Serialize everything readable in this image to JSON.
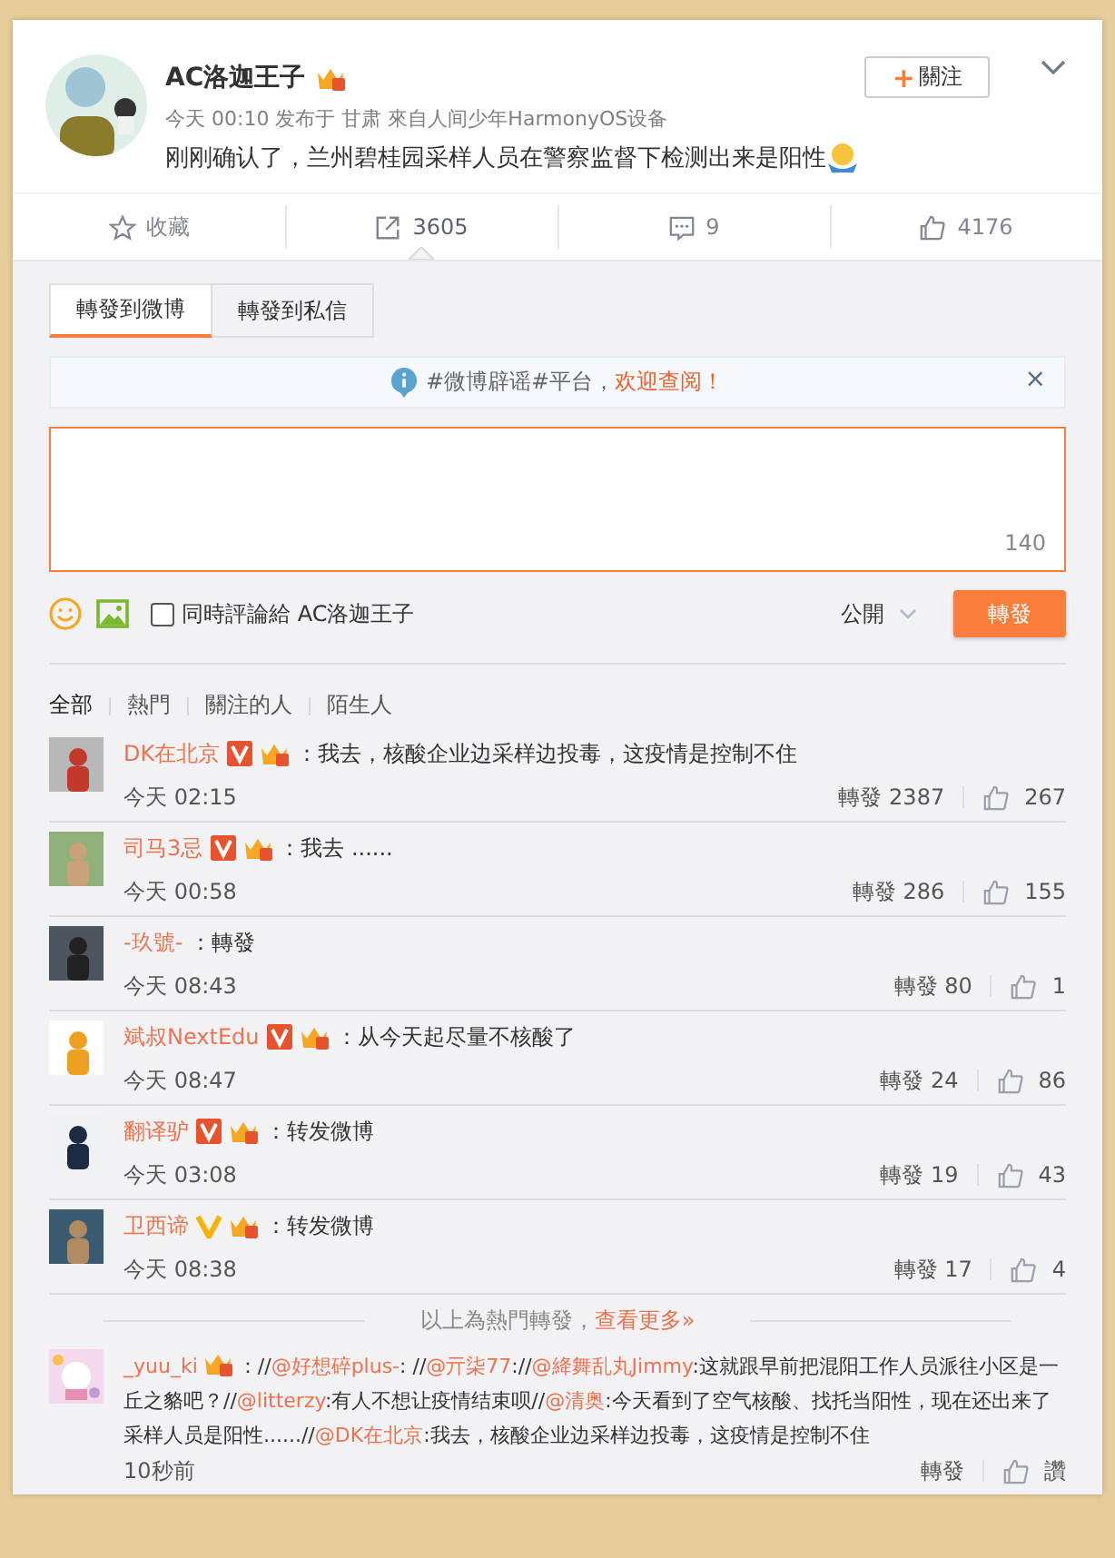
{
  "post": {
    "author": "AC洛迦王子",
    "member": true,
    "follow_button": "關注",
    "follow_plus": "+",
    "meta": "今天 00:10 发布于 甘肃 來自人间少年HarmonyOS设备",
    "text": "刚刚确认了，兰州碧桂园采样人员在警察监督下检测出来是阳性",
    "emoji": true
  },
  "actions": [
    {
      "kind": "favorite",
      "label": "收藏",
      "selected": false
    },
    {
      "kind": "repost",
      "label": "3605",
      "selected": true
    },
    {
      "kind": "comment",
      "label": "9",
      "selected": false
    },
    {
      "kind": "like",
      "label": "4176",
      "selected": false
    }
  ],
  "repost_tabs": [
    {
      "label": "轉發到微博",
      "selected": true
    },
    {
      "label": "轉發到私信",
      "selected": false
    }
  ],
  "notice": {
    "text": "#微博辟谣#平台，",
    "link": "欢迎查阅！",
    "close": "×"
  },
  "composer": {
    "counter": "140",
    "checkbox": {
      "label": "同時評論給 AC洛迦王子",
      "checked": false
    },
    "visibility": "公開",
    "submit": "轉發"
  },
  "filters": [
    {
      "label": "全部",
      "selected": true
    },
    {
      "label": "熱門",
      "selected": false
    },
    {
      "label": "關注的人",
      "selected": false
    },
    {
      "label": "陌生人",
      "selected": false
    }
  ],
  "reposts": [
    {
      "name": "DK在北京",
      "kind": "verified",
      "member": true,
      "text": "：我去，核酸企业边采样边投毒，这疫情是控制不住",
      "time": "今天 02:15",
      "repost": "轉發 2387",
      "likes": "267"
    },
    {
      "name": "司马3忌",
      "kind": "verified",
      "member": true,
      "text": "：我去 ......",
      "time": "今天 00:58",
      "repost": "轉發 286",
      "likes": "155"
    },
    {
      "name": "-玖號-",
      "kind": "plain",
      "member": false,
      "text": "：轉發",
      "time": "今天 08:43",
      "repost": "轉發 80",
      "likes": "1"
    },
    {
      "name": "斌叔NextEdu",
      "kind": "verified",
      "member": true,
      "text": "：从今天起尽量不核酸了",
      "time": "今天 08:47",
      "repost": "轉發 24",
      "likes": "86"
    },
    {
      "name": "翻译驴",
      "kind": "verified",
      "member": true,
      "text": "：转发微博",
      "time": "今天 03:08",
      "repost": "轉發 19",
      "likes": "43"
    },
    {
      "name": "卫西谛",
      "kind": "vip",
      "member": true,
      "text": "：转发微博",
      "time": "今天 08:38",
      "repost": "轉發 17",
      "likes": "4"
    }
  ],
  "more": {
    "text": "以上為熱門轉發，",
    "link": "查看更多»"
  },
  "latest": {
    "name": "_yuu_ki",
    "member": true,
    "segments": [
      {
        "kind": "text",
        "text": "：//"
      },
      {
        "kind": "mention",
        "text": "@好想碎plus-"
      },
      {
        "kind": "text",
        "text": ": //"
      },
      {
        "kind": "mention",
        "text": "@亓柒77"
      },
      {
        "kind": "text",
        "text": "://"
      },
      {
        "kind": "mention",
        "text": "@絳舞乱丸Jimmy"
      },
      {
        "kind": "text",
        "text": ":这就跟早前把混阳工作人员派往小区是一丘之貉吧？//"
      },
      {
        "kind": "mention",
        "text": "@litterzy"
      },
      {
        "kind": "text",
        "text": ":有人不想让疫情结束呗//"
      },
      {
        "kind": "mention",
        "text": "@清奥"
      },
      {
        "kind": "text",
        "text": ":今天看到了空气核酸、找托当阳性，现在还出来了采样人员是阳性......//"
      },
      {
        "kind": "mention",
        "text": "@DK在北京"
      },
      {
        "kind": "text",
        "text": ":我去，核酸企业边采样边投毒，这疫情是控制不住"
      }
    ],
    "time": "10秒前",
    "repost": "轉發",
    "likes": "讚"
  }
}
